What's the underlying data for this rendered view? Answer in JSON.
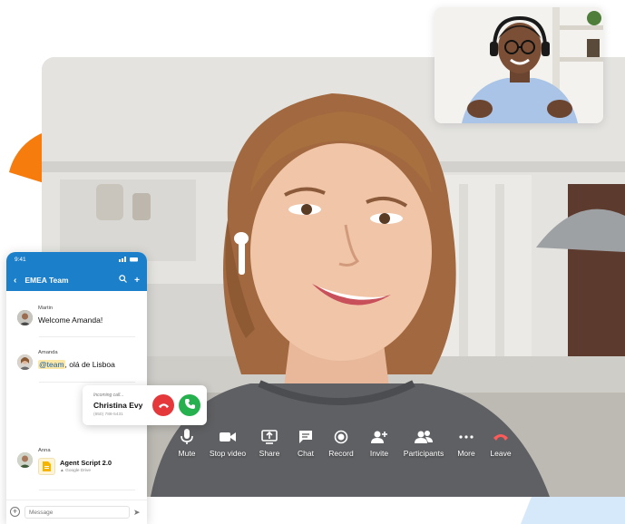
{
  "toolbar": {
    "items": [
      {
        "label": "Mute",
        "icon": "microphone-icon"
      },
      {
        "label": "Stop video",
        "icon": "video-camera-icon"
      },
      {
        "label": "Share",
        "icon": "screen-share-icon"
      },
      {
        "label": "Chat",
        "icon": "chat-bubble-icon"
      },
      {
        "label": "Record",
        "icon": "record-icon"
      },
      {
        "label": "Invite",
        "icon": "add-person-icon"
      },
      {
        "label": "Participants",
        "icon": "participants-icon"
      },
      {
        "label": "More",
        "icon": "more-dots-icon"
      },
      {
        "label": "Leave",
        "icon": "hang-up-icon"
      }
    ]
  },
  "phone": {
    "status_time": "9:41",
    "header_title": "EMEA Team",
    "messages": [
      {
        "author": "Martin",
        "text": "Welcome Amanda!"
      },
      {
        "author": "Amanda",
        "mention": "@team",
        "text": ", olá de Lisboa"
      },
      {
        "author": "Anna",
        "file_title": "Agent Script 2.0",
        "file_source": "Google Drive"
      }
    ],
    "composer_placeholder": "Message"
  },
  "call": {
    "label": "Incoming call...",
    "caller": "Christina Evy",
    "number": "(650) 788-5431"
  },
  "colors": {
    "brand_blue": "#1c7fc9",
    "decline_red": "#e5383b",
    "accept_green": "#27b04e",
    "accent_orange": "#f57c0d",
    "accent_light_blue": "#d6e9fb",
    "leave_red": "#ff5a5a"
  }
}
